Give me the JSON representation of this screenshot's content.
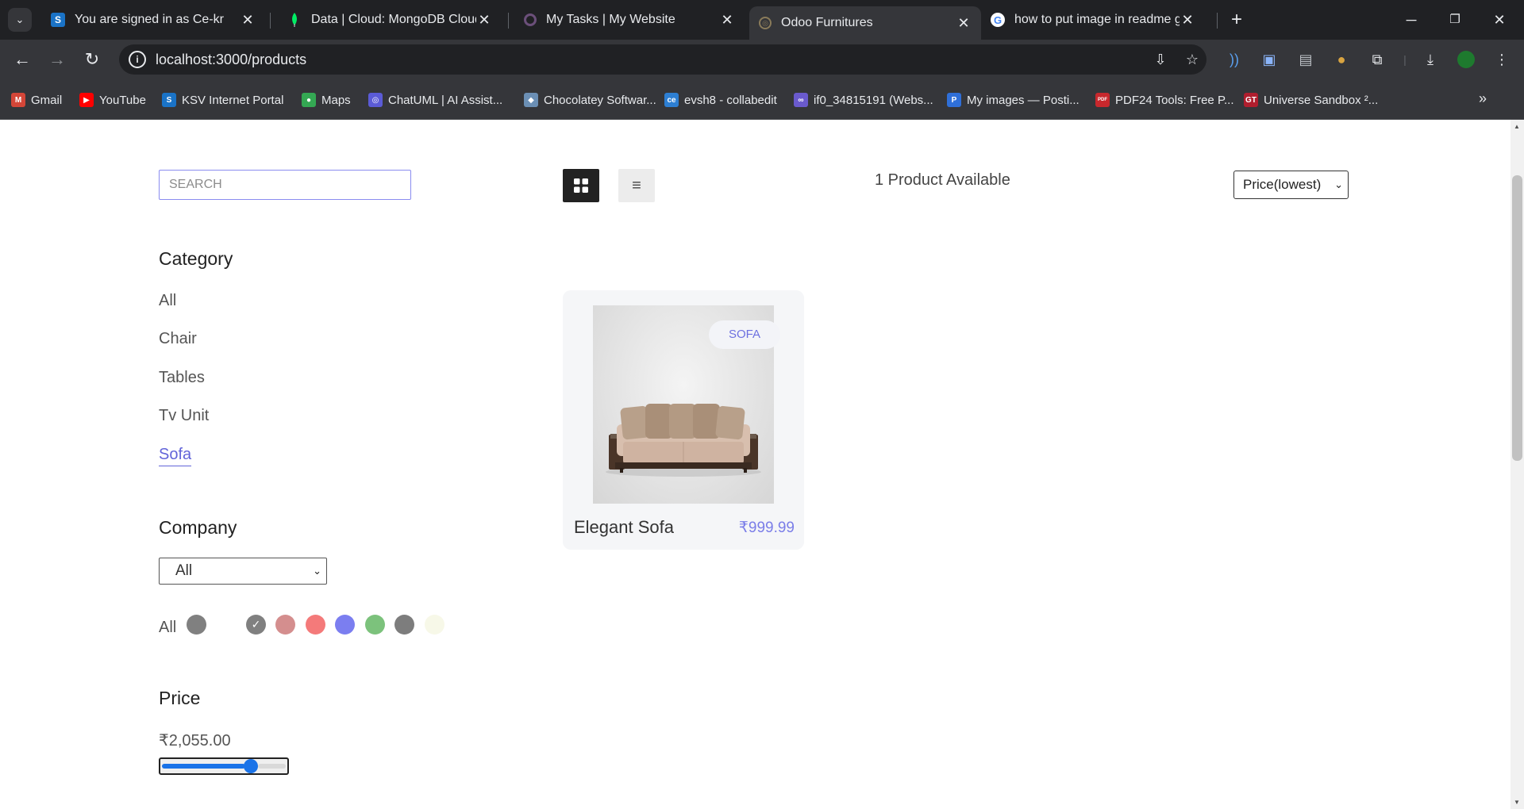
{
  "browser": {
    "tabs": [
      {
        "title": "You are signed in as Ce-kr",
        "favicon": "s-icon",
        "color": "#1a73c7",
        "glyph": "S"
      },
      {
        "title": "Data | Cloud: MongoDB Cloud",
        "favicon": "mongodb-leaf-icon",
        "color": "#00ed64",
        "glyph": ""
      },
      {
        "title": "My Tasks | My Website",
        "favicon": "ring-icon",
        "color": "#6b4f7a",
        "glyph": ""
      },
      {
        "title": "Odoo Furnitures",
        "favicon": "globe-icon",
        "color": "#8a7b5a",
        "glyph": ""
      },
      {
        "title": "how to put image in readme gi",
        "favicon": "google-icon",
        "color": "#ffffff",
        "glyph": "G"
      }
    ],
    "url": "localhost:3000/products",
    "bookmarks": [
      {
        "label": "Gmail",
        "icon": "gmail-icon",
        "color": "#d44638",
        "glyph": "M"
      },
      {
        "label": "YouTube",
        "icon": "youtube-icon",
        "color": "#ff0000",
        "glyph": "▶"
      },
      {
        "label": "KSV Internet Portal",
        "icon": "s-icon",
        "color": "#1a73c7",
        "glyph": "S"
      },
      {
        "label": "Maps",
        "icon": "maps-pin-icon",
        "color": "#34a853",
        "glyph": "●"
      },
      {
        "label": "ChatUML | AI Assist...",
        "icon": "chatuml-icon",
        "color": "#5b5bd6",
        "glyph": "◎"
      },
      {
        "label": "Chocolatey Softwar...",
        "icon": "chocolatey-icon",
        "color": "#6b8fb5",
        "glyph": "◆"
      },
      {
        "label": "evsh8 - collabedit",
        "icon": "ce-icon",
        "color": "#2d7fd3",
        "glyph": "ce"
      },
      {
        "label": "if0_34815191 (Webs...",
        "icon": "infinity-icon",
        "color": "#6a5acd",
        "glyph": "∞"
      },
      {
        "label": "My images — Posti...",
        "icon": "postimages-icon",
        "color": "#2f6fd8",
        "glyph": "P"
      },
      {
        "label": "PDF24 Tools: Free P...",
        "icon": "pdf24-icon",
        "color": "#c8282d",
        "glyph": "PDF"
      },
      {
        "label": "Universe Sandbox ²...",
        "icon": "gametrek-icon",
        "color": "#b01e2e",
        "glyph": "GT"
      }
    ]
  },
  "page": {
    "search_placeholder": "SEARCH",
    "category_title": "Category",
    "categories": [
      "All",
      "Chair",
      "Tables",
      "Tv Unit",
      "Sofa"
    ],
    "active_category": "Sofa",
    "company_title": "Company",
    "company_value": "All",
    "colors_all_label": "All",
    "colors": [
      "#808080",
      "#808080",
      "#d48e8e",
      "#f47a7a",
      "#7b7ef0",
      "#7cc27c",
      "#7d7d7d",
      "#f7f8e8"
    ],
    "selected_color_index": 1,
    "price_title": "Price",
    "price_value": "₹2,055.00",
    "price_slider_fraction": 0.73,
    "products_available": "1 Product Available",
    "sort_value": "Price(lowest)",
    "view_mode": "grid",
    "product": {
      "name": "Elegant Sofa",
      "price": "₹999.99",
      "tag": "SOFA"
    },
    "accent": "#6264d9"
  }
}
